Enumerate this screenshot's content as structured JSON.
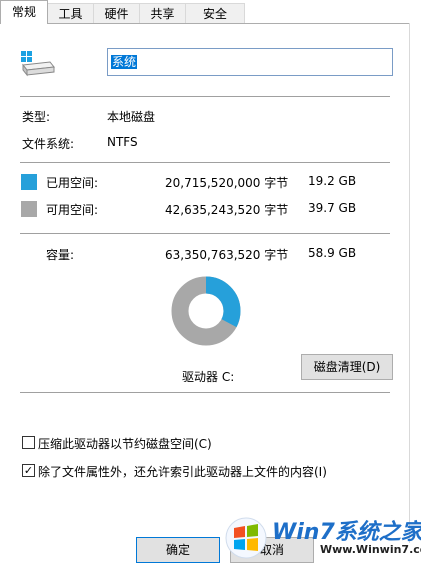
{
  "tabs": [
    "常规",
    "工具",
    "硬件",
    "共享",
    "安全"
  ],
  "drive_name": "系统",
  "type_label": "类型:",
  "type_value": "本地磁盘",
  "fs_label": "文件系统:",
  "fs_value": "NTFS",
  "used": {
    "label": "已用空间:",
    "bytes": "20,715,520,000 字节",
    "size": "19.2 GB",
    "color": "#26a0da"
  },
  "free": {
    "label": "可用空间:",
    "bytes": "42,635,243,520 字节",
    "size": "39.7 GB",
    "color": "#a8a8a8"
  },
  "capacity": {
    "label": "容量:",
    "bytes": "63,350,763,520 字节",
    "size": "58.9 GB"
  },
  "pie": {
    "used_fraction": 0.327
  },
  "drive_label": "驱动器 C:",
  "cleanup_button": "磁盘清理(D)",
  "compress_checkbox": {
    "label": "压缩此驱动器以节约磁盘空间(C)",
    "checked": false
  },
  "index_checkbox": {
    "label": "除了文件属性外，还允许索引此驱动器上文件的内容(I)",
    "checked": true
  },
  "ok_button": "确定",
  "cancel_button": "取消",
  "watermark": {
    "text": "Win7系统之家",
    "url": "Www.Winwin7.com"
  }
}
